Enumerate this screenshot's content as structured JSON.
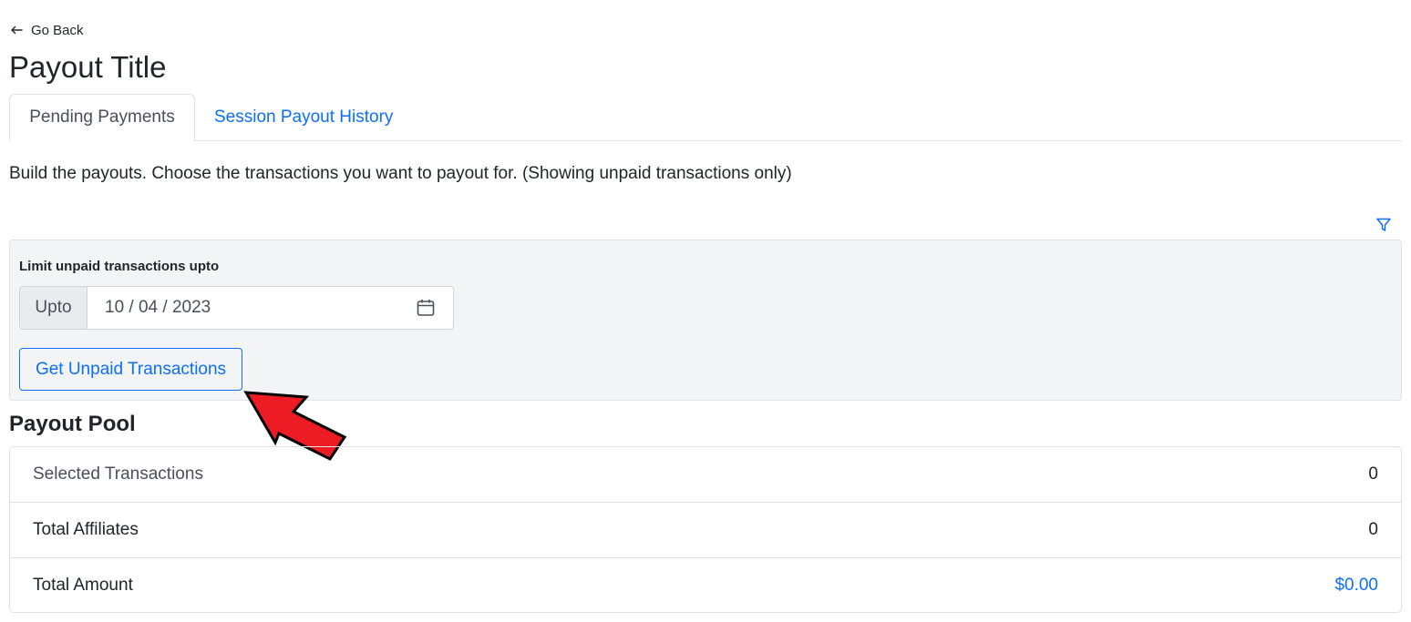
{
  "nav": {
    "go_back": "Go Back"
  },
  "page": {
    "title": "Payout Title",
    "intro": "Build the payouts. Choose the transactions you want to payout for. (Showing unpaid transactions only)"
  },
  "tabs": [
    {
      "label": "Pending Payments",
      "active": true
    },
    {
      "label": "Session Payout History",
      "active": false
    }
  ],
  "filter": {
    "label": "Limit unpaid transactions upto",
    "prefix": "Upto",
    "date_value": "10 / 04 / 2023",
    "button": "Get Unpaid Transactions",
    "icon": "filter-icon"
  },
  "payout_pool": {
    "title": "Payout Pool",
    "rows": [
      {
        "label": "Selected Transactions",
        "value": "0"
      },
      {
        "label": "Total Affiliates",
        "value": "0"
      },
      {
        "label": "Total Amount",
        "value": "$0.00"
      }
    ]
  },
  "colors": {
    "link": "#0d6efd",
    "card_bg": "#f3f4f6",
    "annotation_arrow": "#ed1c24"
  }
}
